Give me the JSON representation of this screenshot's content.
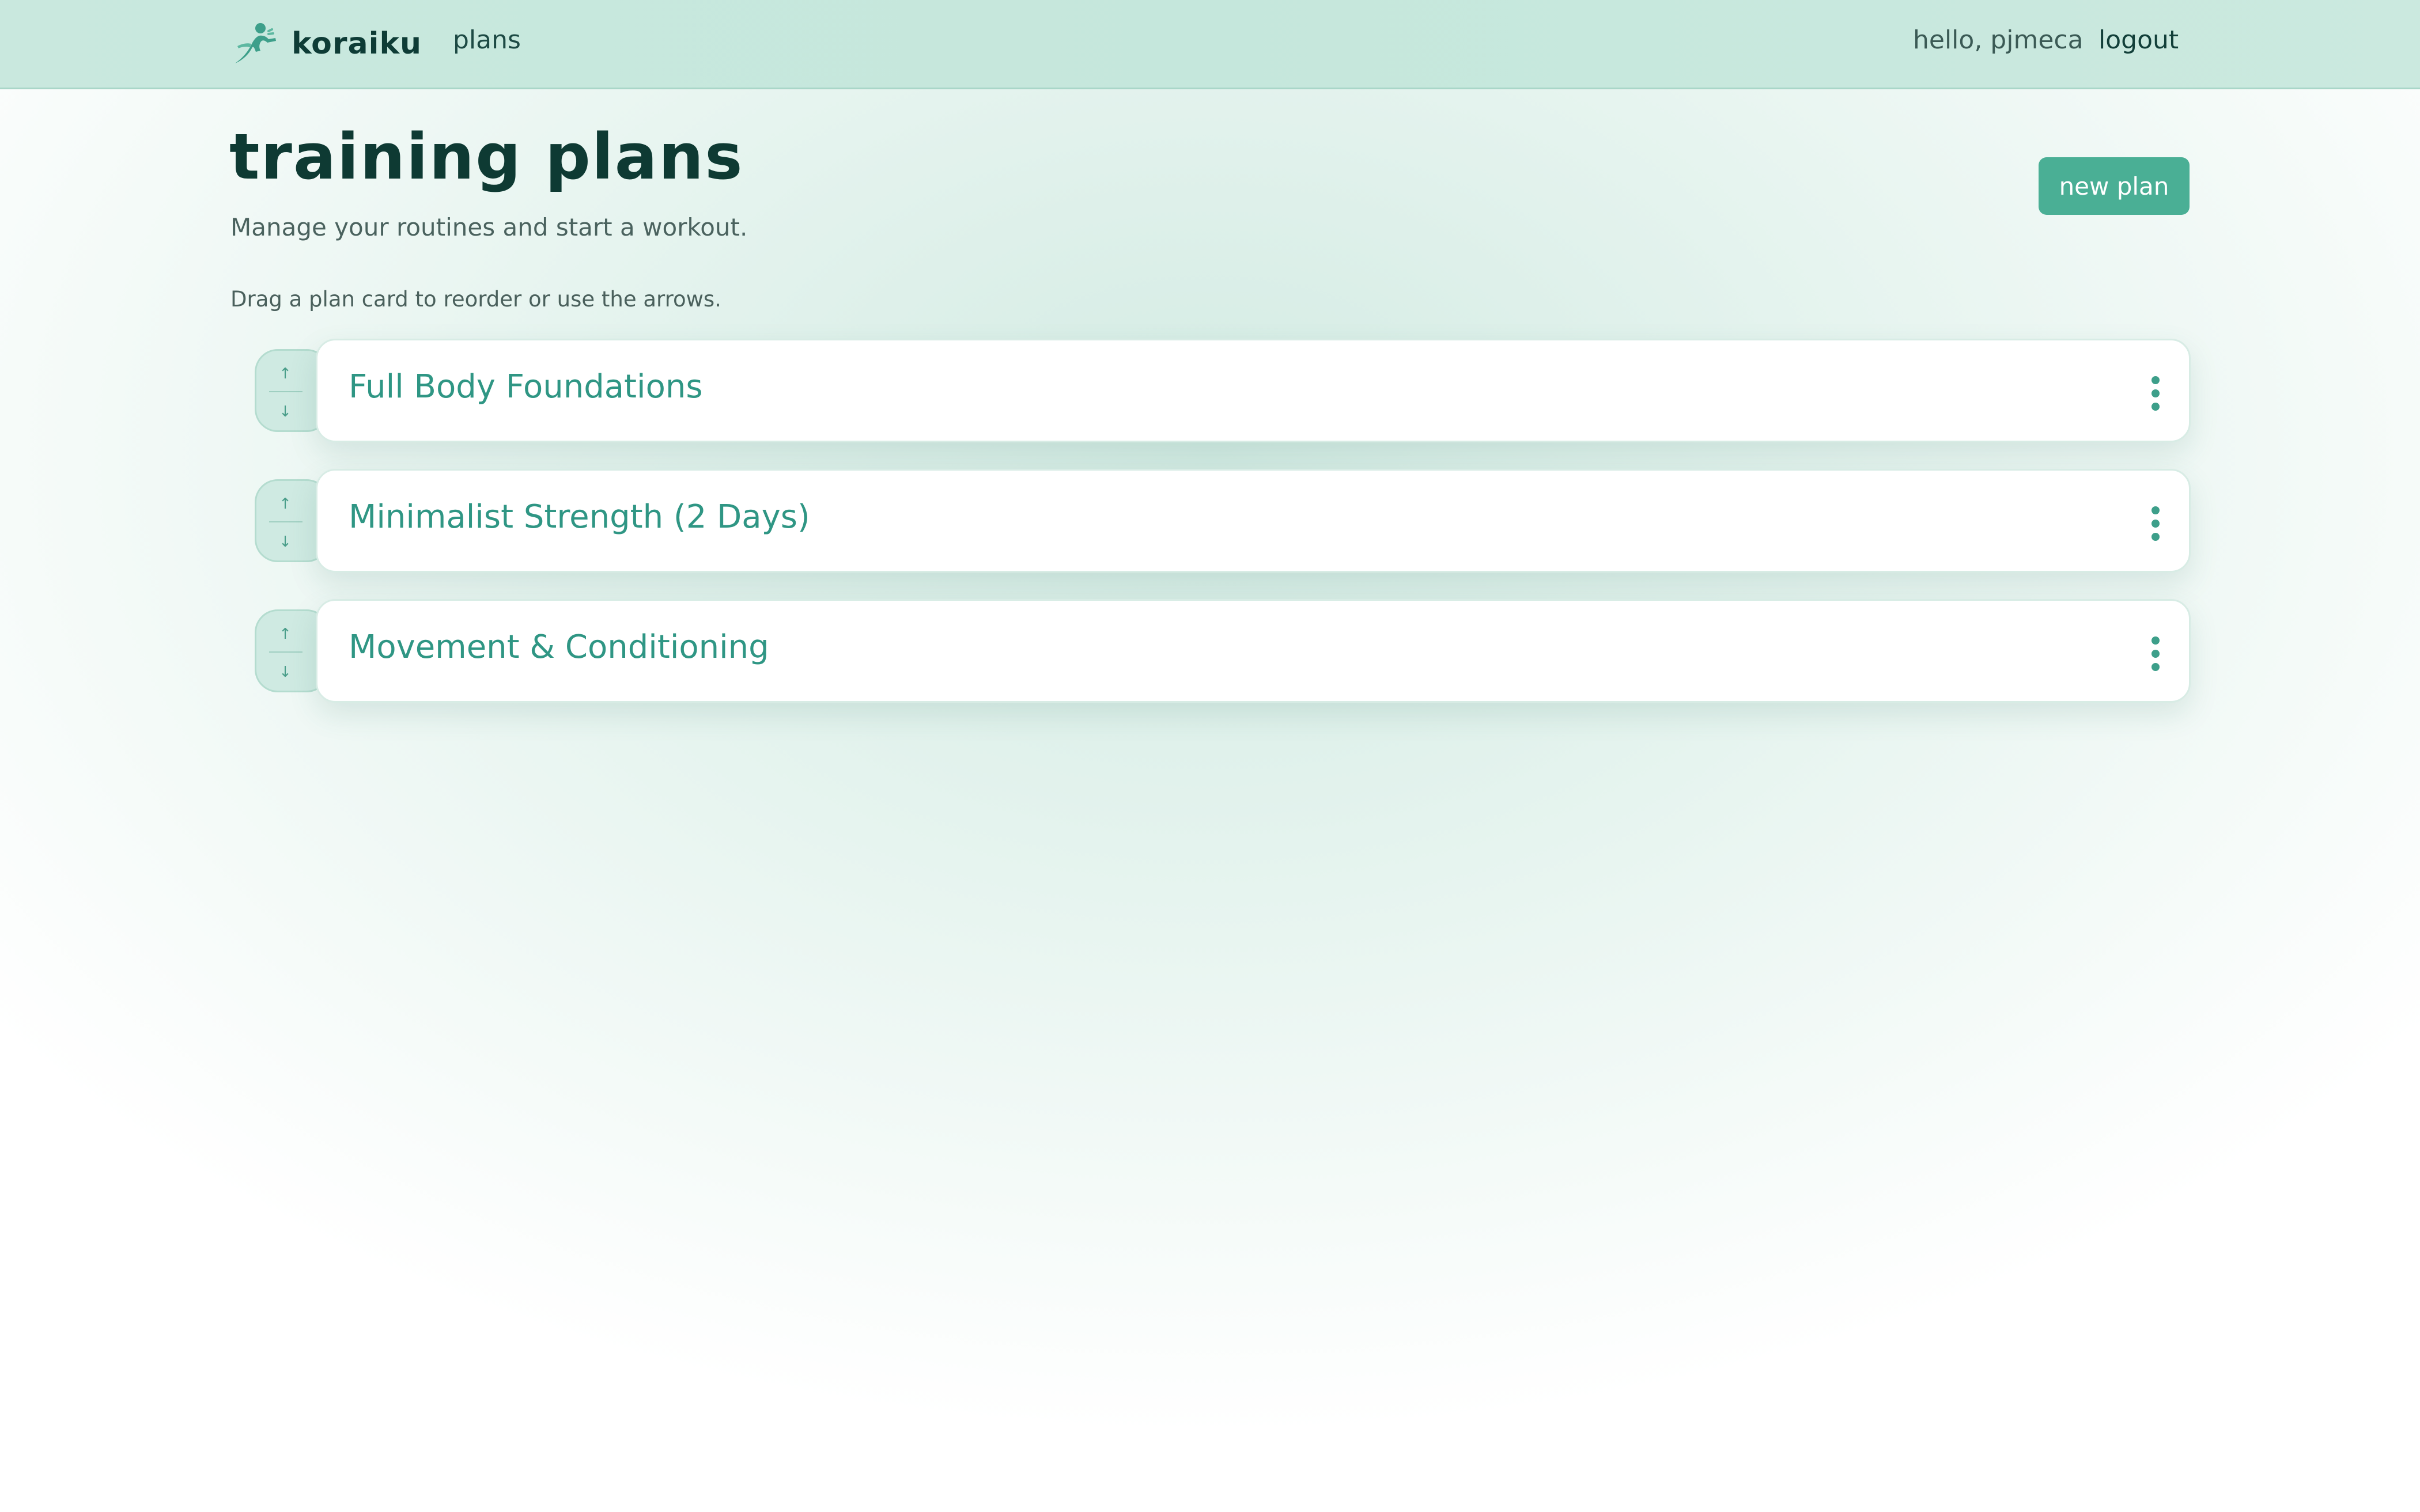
{
  "app": {
    "brand_name": "koraiku",
    "brand_icon": "runner-icon"
  },
  "nav": {
    "plans_label": "plans"
  },
  "user": {
    "greeting": "hello, pjmeca",
    "logout_label": "logout"
  },
  "header": {
    "title": "training plans",
    "subtitle": "Manage your routines and start a workout.",
    "new_plan_label": "new plan"
  },
  "hint": "Drag a plan card to reorder or use the arrows.",
  "plans": [
    {
      "name": "Full Body Foundations"
    },
    {
      "name": "Minimalist Strength (2 Days)"
    },
    {
      "name": "Movement & Conditioning"
    }
  ],
  "icons": {
    "move_up": "↑",
    "move_down": "↓"
  },
  "colors": {
    "accent": "#4aaf95",
    "topbar": "#c5e7dc",
    "title": "#0e3a33",
    "plan_name": "#2f9684"
  }
}
